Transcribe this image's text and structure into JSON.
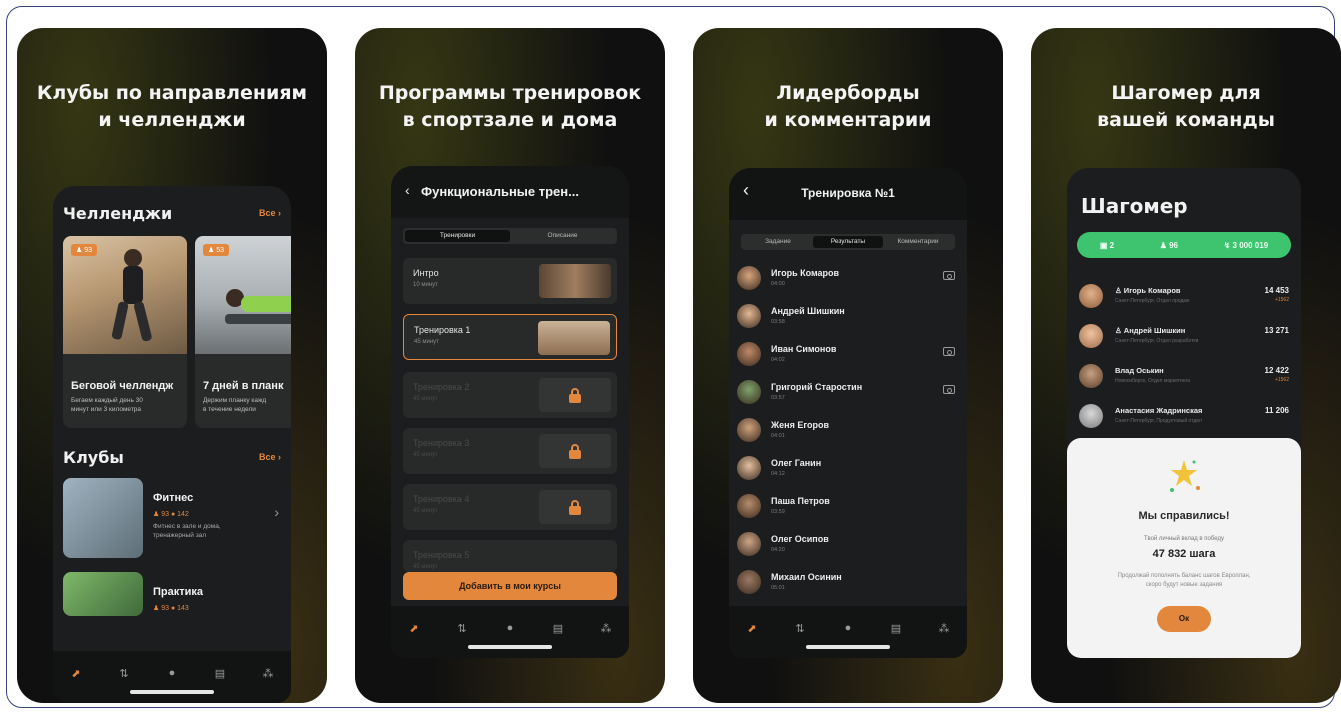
{
  "panels": [
    {
      "title": "Клубы по направлениям\nи челленджи"
    },
    {
      "title": "Программы тренировок\nв спортзале и дома"
    },
    {
      "title": "Лидерборды\nи комментарии"
    },
    {
      "title": "Шагомер для\nвашей команды"
    }
  ],
  "clubs_screen": {
    "challenges_title": "Челленджи",
    "see_all": "Все ›",
    "challenges": [
      {
        "badge": "♟ 93",
        "title": "Беговой челлендж",
        "desc": "Бегаем каждый день 30\nминут или 3 километра"
      },
      {
        "badge": "♟ 53",
        "title": "7 дней в планк",
        "desc": "Держим планку кажд\nв течение недели"
      }
    ],
    "clubs_title": "Клубы",
    "clubs": [
      {
        "name": "Фитнес",
        "stats": "♟ 93   ● 142",
        "desc": "Фитнес в зале и дома,\nтренажерный зал"
      },
      {
        "name": "Практика",
        "stats": "♟ 93   ● 143",
        "desc": ""
      }
    ]
  },
  "program_screen": {
    "title": "Функциональные трен...",
    "segments": [
      "Тренировки",
      "Описание"
    ],
    "lessons": [
      {
        "title": "Интро",
        "sub": "10 минут"
      },
      {
        "title": "Тренировка 1",
        "sub": "45 минут"
      },
      {
        "title": "Тренировка 2",
        "sub": "45 минут"
      },
      {
        "title": "Тренировка 3",
        "sub": "45 минут"
      },
      {
        "title": "Тренировка 4",
        "sub": "45 минут"
      },
      {
        "title": "Тренировка 5",
        "sub": "45 минут"
      }
    ],
    "add_button": "Добавить в мои курсы"
  },
  "leaderboard_screen": {
    "title": "Тренировка №1",
    "segments": [
      "Задание",
      "Результаты",
      "Комментарии"
    ],
    "rows": [
      {
        "name": "Игорь Комаров",
        "time": "04:00",
        "camera": true
      },
      {
        "name": "Андрей Шишкин",
        "time": "03:58",
        "camera": false
      },
      {
        "name": "Иван Симонов",
        "time": "04:02",
        "camera": true
      },
      {
        "name": "Григорий Старостин",
        "time": "03:57",
        "camera": true
      },
      {
        "name": "Женя Егоров",
        "time": "04:01",
        "camera": false
      },
      {
        "name": "Олег Ганин",
        "time": "04:12",
        "camera": false
      },
      {
        "name": "Паша Петров",
        "time": "03:59",
        "camera": false
      },
      {
        "name": "Олег Осипов",
        "time": "04:20",
        "camera": false
      },
      {
        "name": "Михаил Осинин",
        "time": "05:01",
        "camera": false
      }
    ]
  },
  "pedometer_screen": {
    "title": "Шагомер",
    "pill": [
      "▣ 2",
      "♟ 96",
      "↯ 3 000 019"
    ],
    "rows": [
      {
        "name": "♙ Игорь Комаров",
        "sub": "Санкт-Петербург, Отдел продаж",
        "value": "14 453",
        "delta": "+1562"
      },
      {
        "name": "♙ Андрей Шишкин",
        "sub": "Санкт-Петербург, Отдел разработки",
        "value": "13 271",
        "delta": ""
      },
      {
        "name": "Влад Оськин",
        "sub": "Новосибирск, Отдел маркетинга",
        "value": "12 422",
        "delta": "+1562"
      },
      {
        "name": "Анастасия Жадринская",
        "sub": "Санкт-Петербург, Продуктовый отдел",
        "value": "11 206",
        "delta": ""
      }
    ],
    "modal": {
      "title": "Мы справились!",
      "subtitle": "Твой личный вклад в победу",
      "value": "47 832 шага",
      "note": "Продолжай пополнять баланс шагов Европлан,\nскоро будут новые задания",
      "ok": "Ок"
    }
  },
  "colors": {
    "accent": "#e3873d",
    "green": "#3ec46f",
    "bg": "#101010"
  }
}
